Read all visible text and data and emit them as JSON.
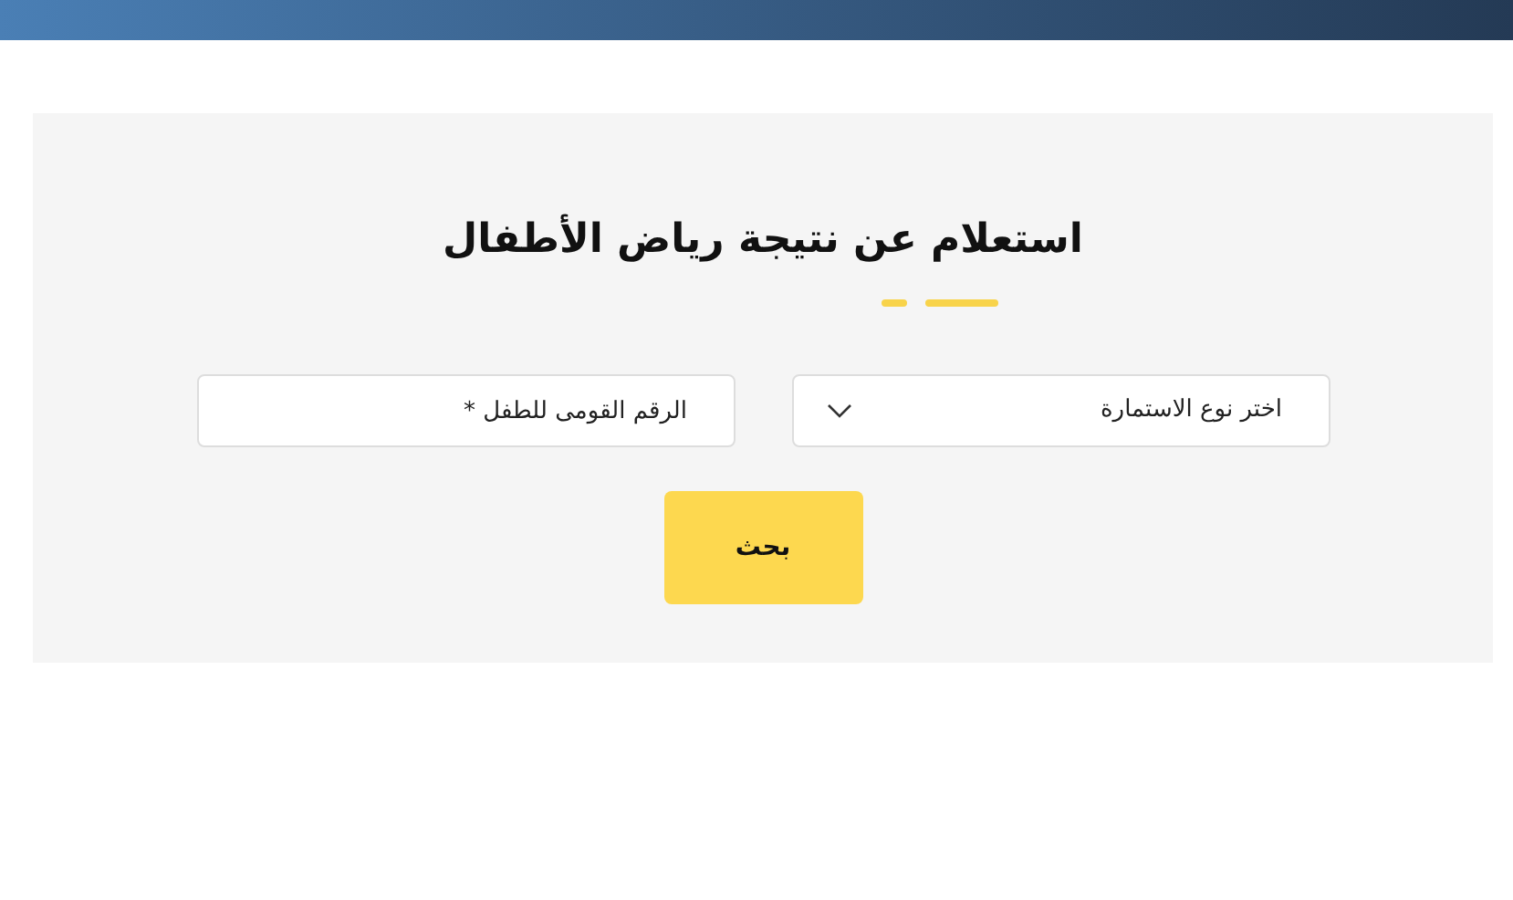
{
  "form": {
    "title": "استعلام عن نتيجة رياض الأطفال",
    "form_type_select": {
      "value": "اختر نوع الاستمارة"
    },
    "national_id_field": {
      "placeholder": "الرقم القومى للطفل *"
    },
    "search_button": "بحث"
  }
}
